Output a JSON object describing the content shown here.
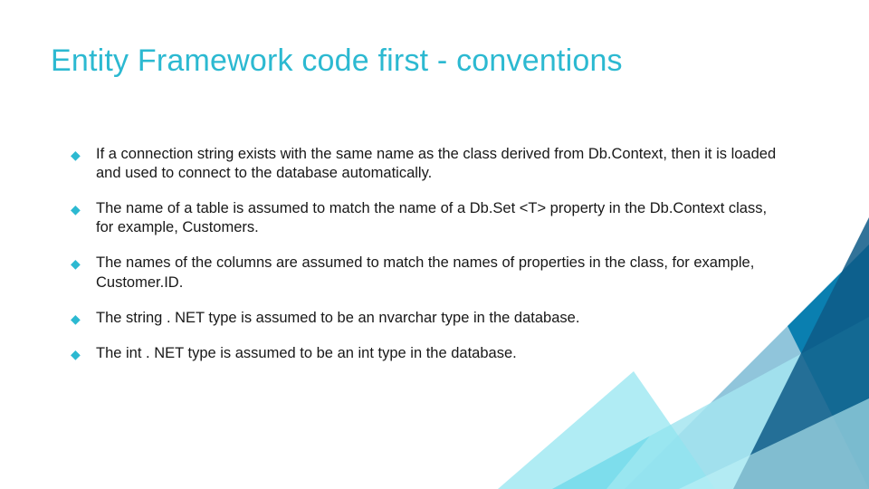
{
  "title": "Entity Framework code first - conventions",
  "bullet_glyph": "◆",
  "bullets": [
    "If a connection string exists with the same name as the class derived from Db.Context, then it is loaded and used to connect to the database automatically.",
    "The name of a table is assumed to match the name of a Db.Set <T> property in the Db.Context class, for example, Customers.",
    "The names of the columns are assumed to match the names of properties in the class, for example, Customer.ID.",
    "The string . NET type is assumed to be an nvarchar type in the database.",
    "The int . NET type is assumed to be an int type in the database."
  ],
  "colors": {
    "accent": "#2cb9d1",
    "text": "#181818"
  }
}
